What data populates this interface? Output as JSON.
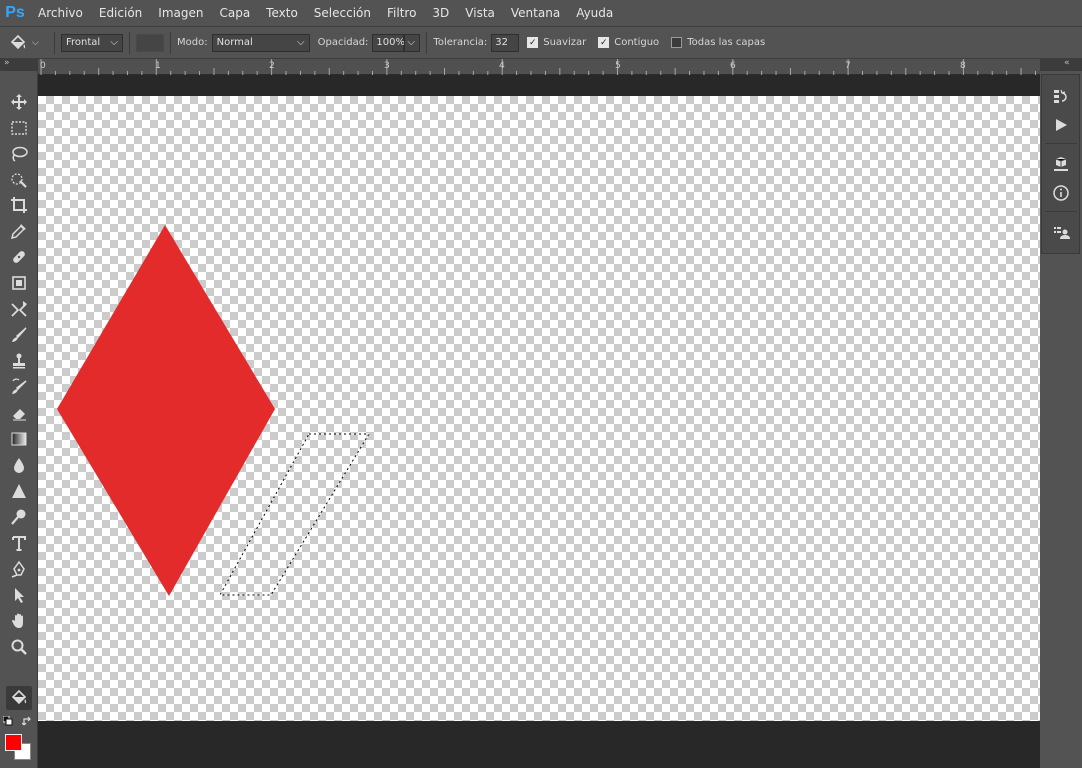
{
  "app": {
    "logo": "Ps",
    "menu": [
      "Archivo",
      "Edición",
      "Imagen",
      "Capa",
      "Texto",
      "Selección",
      "Filtro",
      "3D",
      "Vista",
      "Ventana",
      "Ayuda"
    ]
  },
  "options": {
    "tool_icon": "paint-bucket-icon",
    "fill_source": "Frontal",
    "mode_label": "Modo:",
    "mode_value": "Normal",
    "opacity_label": "Opacidad:",
    "opacity_value": "100%",
    "tolerance_label": "Tolerancia:",
    "tolerance_value": "32",
    "smooth_label": "Suavizar",
    "smooth_checked": true,
    "contiguous_label": "Contiguo",
    "contiguous_checked": true,
    "all_layers_label": "Todas las capas",
    "all_layers_checked": false
  },
  "panel_toggles": {
    "left": "»",
    "right": "«"
  },
  "ruler": {
    "labels": [
      "0",
      "1",
      "2",
      "3",
      "4",
      "5",
      "6",
      "7",
      "8"
    ]
  },
  "tools": [
    {
      "name": "move-tool",
      "icon": "move-icon"
    },
    {
      "name": "marquee-tool",
      "icon": "rectangular-marquee-icon"
    },
    {
      "name": "lasso-tool",
      "icon": "lasso-icon"
    },
    {
      "name": "quick-selection-tool",
      "icon": "quick-selection-icon"
    },
    {
      "name": "crop-tool",
      "icon": "crop-icon"
    },
    {
      "name": "eyedropper-tool",
      "icon": "eyedropper-icon"
    },
    {
      "name": "healing-brush-tool",
      "icon": "bandage-icon"
    },
    {
      "name": "patch-tool",
      "icon": "patch-icon"
    },
    {
      "name": "content-aware-move-tool",
      "icon": "content-aware-move-icon"
    },
    {
      "name": "brush-tool",
      "icon": "brush-icon"
    },
    {
      "name": "clone-stamp-tool",
      "icon": "stamp-icon"
    },
    {
      "name": "history-brush-tool",
      "icon": "history-brush-icon"
    },
    {
      "name": "eraser-tool",
      "icon": "eraser-icon"
    },
    {
      "name": "gradient-tool",
      "icon": "gradient-icon"
    },
    {
      "name": "blur-tool",
      "icon": "drop-icon"
    },
    {
      "name": "sharpen-tool",
      "icon": "triangle-icon"
    },
    {
      "name": "dodge-tool",
      "icon": "dodge-icon"
    },
    {
      "name": "type-tool",
      "icon": "type-icon"
    },
    {
      "name": "pen-tool",
      "icon": "pen-icon"
    },
    {
      "name": "path-selection-tool",
      "icon": "arrow-icon"
    },
    {
      "name": "hand-tool",
      "icon": "hand-icon"
    },
    {
      "name": "zoom-tool",
      "icon": "magnifier-icon"
    },
    {
      "name": "paint-bucket-tool",
      "icon": "paint-bucket-icon",
      "active": true
    }
  ],
  "colors": {
    "foreground": "#ff0000",
    "background": "#ffffff",
    "diamond": "#e32b2b"
  },
  "dock": [
    {
      "name": "history-panel-button",
      "icon": "history-icon"
    },
    {
      "name": "actions-panel-button",
      "icon": "play-icon"
    },
    {
      "name": "3d-panel-button",
      "icon": "cube-icon"
    },
    {
      "name": "info-panel-button",
      "icon": "info-icon"
    },
    {
      "name": "layer-comps-panel-button",
      "icon": "layer-comps-icon"
    }
  ]
}
